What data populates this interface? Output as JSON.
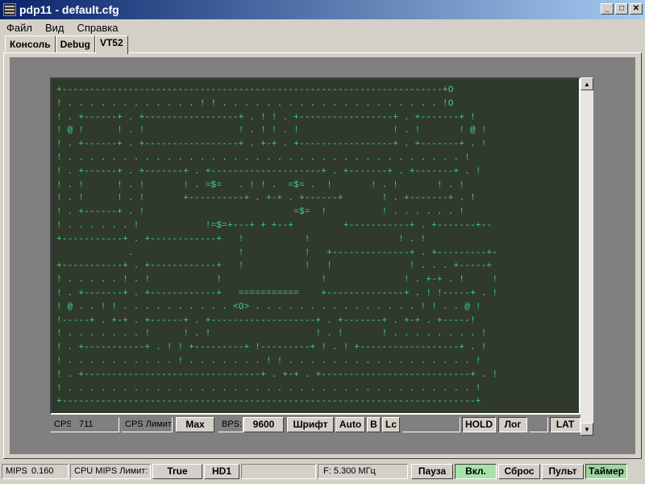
{
  "window": {
    "title": "pdp11 - default.cfg",
    "minimize": "_",
    "maximize": "□",
    "close": "✕"
  },
  "menu": [
    "Файл",
    "Вид",
    "Справка"
  ],
  "tabs": [
    "Консоль",
    "Debug",
    "VT52"
  ],
  "terminal": {
    "lines": [
      "+---------------------------------------------------------------------+O",
      "! . . . . . . . . . . . . ! ! . . . . . . . . . . . . . . . . . . . . !O",
      "! . +------+ . +-----------------+ . ! ! . +-----------------+ . +-------+ !",
      "! @ !      ! . !                 ! . ! ! . !                 ! . !       ! @ !",
      "! . +------+ . +-----------------+ . +-+ . +-----------------+ . +-------+ . !",
      "! . . . . . . . . . . . . . . . . . . . . . . . . . . . . . . . . . . . . !",
      "! . +------+ . +-------+ . +--------------------+ . +-------+ . +-------+ . !",
      "! . !      ! . !       ! . =$=   . ! ! .  =$= .  !       ! . !       ! . !",
      "! . !      ! . !       +----------+ . +-+ . +------+       ! . +-------+ . !",
      "! . +------+ . !                           =$=  !          ! . . . . . . !",
      "! . . . . . . !            !=$=+---+ + +--+         +-----------+ . +-------+--",
      "+-----------+ . +------------+   !           !                ! . !",
      "             .                   !           !   +--------------+ . +---------+-",
      "+-----------+ . +------------+   !           !   !              ! . . . +-----+",
      "! . . . . . ! . !            !                  !              ! . +-+ . !     !",
      "! . +-------+ . +------------+   ===========    +--------------+ . ! !-----+ . !",
      "! @ . . ! ! . . . . . . . . . . <O> . . . . . . . . . . . . . . . ! ! . . @ !",
      "!-----+ . +-+ . +------+ . +-------------------+ . +-------+ . +-+ . +-----!",
      "! . . . . . . . !      ! . !                   ! . !       ! . . . . . . . . !",
      "! . +-----------+ . ! ! +---------+ !---------+ ! . ! +------------------+ . !",
      "! . . . . . . . . . . ! . . . . . . . ! ! . . . . . . . . . . . . . . . . . !",
      "! . +--------------------------------+ . +-+ . +---------------------------+ . !",
      "! . . . . . . . . . . . . . . . . . . . . . . . . . . . . . . . . . . . . . !",
      "+---------------------------------------------------------------------------+"
    ]
  },
  "term_status": {
    "cps_label": "CPS:",
    "cps_value": "711",
    "cps_limit_label": "CPS Лимит:",
    "cps_limit_value": "Max",
    "bps_label": "BPS:",
    "bps_value": "9600",
    "font_btn": "Шрифт",
    "auto_btn": "Auto",
    "b_btn": "B",
    "lc_btn": "Lc",
    "hold_btn": "HOLD",
    "log_btn": "Лог",
    "lat_btn": "LAT"
  },
  "status_bar": {
    "mips_label": "MIPS:",
    "mips_value": "0.160",
    "cpu_limit_label": "CPU MIPS Лимит:",
    "cpu_limit_value": "True",
    "hd_btn": "HD1",
    "freq": "F: 5.300 МГц",
    "pause_btn": "Пауза",
    "on_btn": "Вкл.",
    "reset_btn": "Сброс",
    "console_btn": "Пульт",
    "timer_btn": "Таймер"
  },
  "colors": {
    "terminal_bg": "#2f3a2d",
    "terminal_fg": "#3fd48a",
    "on_button": "#a6e3a6"
  }
}
